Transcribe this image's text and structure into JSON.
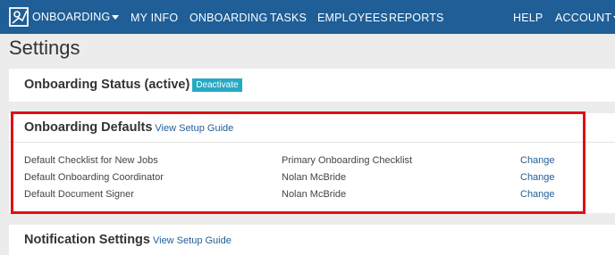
{
  "nav": {
    "brand": "ONBOARDING",
    "items": [
      "MY INFO",
      "ONBOARDING",
      "TASKS",
      "EMPLOYEES",
      "REPORTS"
    ],
    "help": "HELP",
    "account": "ACCOUNT"
  },
  "page": {
    "title": "Settings"
  },
  "status_card": {
    "title": "Onboarding Status (active)",
    "badge": "Deactivate"
  },
  "defaults_card": {
    "title": "Onboarding Defaults",
    "guide_link": "View Setup Guide",
    "rows": [
      {
        "label": "Default Checklist for New Jobs",
        "value": "Primary Onboarding Checklist",
        "action": "Change"
      },
      {
        "label": "Default Onboarding Coordinator",
        "value": "Nolan McBride",
        "action": "Change"
      },
      {
        "label": "Default Document Signer",
        "value": "Nolan McBride",
        "action": "Change"
      }
    ]
  },
  "notify_card": {
    "title": "Notification Settings",
    "guide_link": "View Setup Guide"
  },
  "colors": {
    "nav_bg": "#1f5e96",
    "link": "#1f5e96",
    "badge": "#26a9c5",
    "highlight": "#e10f16"
  }
}
